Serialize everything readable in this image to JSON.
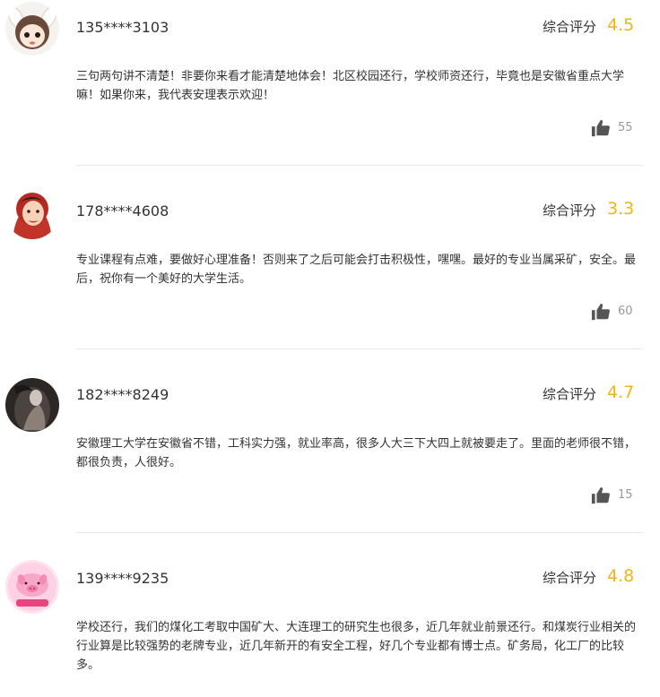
{
  "score_label": "综合评分",
  "reviews": [
    {
      "user": "135****3103",
      "score": "4.5",
      "content": "三句两句讲不清楚！非要你来看才能清楚地体会！北区校园还行，学校师资还行，毕竟也是安徽省重点大学嘛！如果你来，我代表安理表示欢迎！",
      "likes": "55",
      "avatar_icon": "girl-cartoon-avatar-icon"
    },
    {
      "user": "178****4608",
      "score": "3.3",
      "content": "专业课程有点难，要做好心理准备！否则来了之后可能会打击积极性，嘿嘿。最好的专业当属采矿，安全。最后，祝你有一个美好的大学生活。",
      "likes": "60",
      "avatar_icon": "red-hair-girl-avatar-icon"
    },
    {
      "user": "182****8249",
      "score": "4.7",
      "content": "安徽理工大学在安徽省不错，工科实力强，就业率高，很多人大三下大四上就被要走了。里面的老师很不错，都很负责，人很好。",
      "likes": "15",
      "avatar_icon": "dark-figure-avatar-icon"
    },
    {
      "user": "139****9235",
      "score": "4.8",
      "content": "学校还行，我们的煤化工考取中国矿大、大连理工的研究生也很多，近几年就业前景还行。和煤炭行业相关的行业算是比较强势的老牌专业，近几年新开的有安全工程，好几个专业都有博士点。矿务局，化工厂的比较多。",
      "likes": "",
      "avatar_icon": "pink-pig-avatar-icon"
    }
  ],
  "colors": {
    "score": "#f2b316",
    "text": "#333333",
    "muted": "#999999",
    "divider": "#e8e8e8",
    "thumb": "#555555"
  }
}
